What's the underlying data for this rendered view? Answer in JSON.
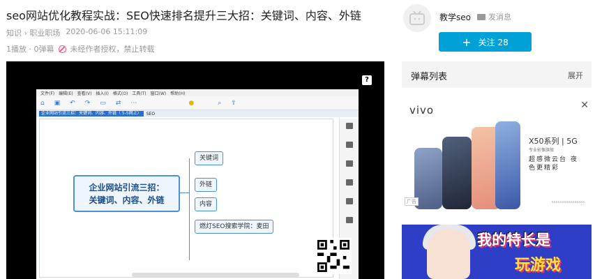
{
  "article": {
    "title": "seo网站优化教程实战：SEO快速排名提升三大招：关键词、内容、外链",
    "category": "知识 › 职业职场",
    "date": "2020-06-06 15:11:09",
    "plays": "1播放 · 0弹幕",
    "rights": "未经作者授权，禁止转载"
  },
  "player": {
    "help_label": "?",
    "menu_items": [
      "文件(F)",
      "编辑(E)",
      "查看(V)",
      "插入(I)",
      "格式(O)",
      "工具(T)",
      "窗口(W)",
      "帮助(H)"
    ],
    "tab_label": "企业网站引流三招：关键词、内容、外链（ 5-5网上）",
    "tab2_label": "SEO",
    "mindmap": {
      "central_line1": "企业网站引流三招：",
      "central_line2": "关键词、内容、外链",
      "nodes": [
        "关键词",
        "外链",
        "内容",
        "燃灯SEO搜索学院：麦田"
      ]
    }
  },
  "uploader": {
    "name": "教学seo",
    "message_label": "发消息",
    "follow_label": "关注 28"
  },
  "danmu": {
    "title": "弹幕列表",
    "expand": "展开"
  },
  "ad1": {
    "brand": "vivo",
    "close": "✕",
    "model": "X50系列 | 5G",
    "model_sub": "专业影像旗舰",
    "slogan": "超感微云台 夜色更精彩",
    "ad_tag": "广告",
    "price_note": "xxxxxxxxxxxxxxxx"
  },
  "ad2": {
    "line1": "我的特长是",
    "line2": "玩游戏"
  },
  "colors": {
    "accent": "#00a1d6",
    "node_border": "#4a90d9",
    "ad2_bg": "#2f3ec6"
  }
}
